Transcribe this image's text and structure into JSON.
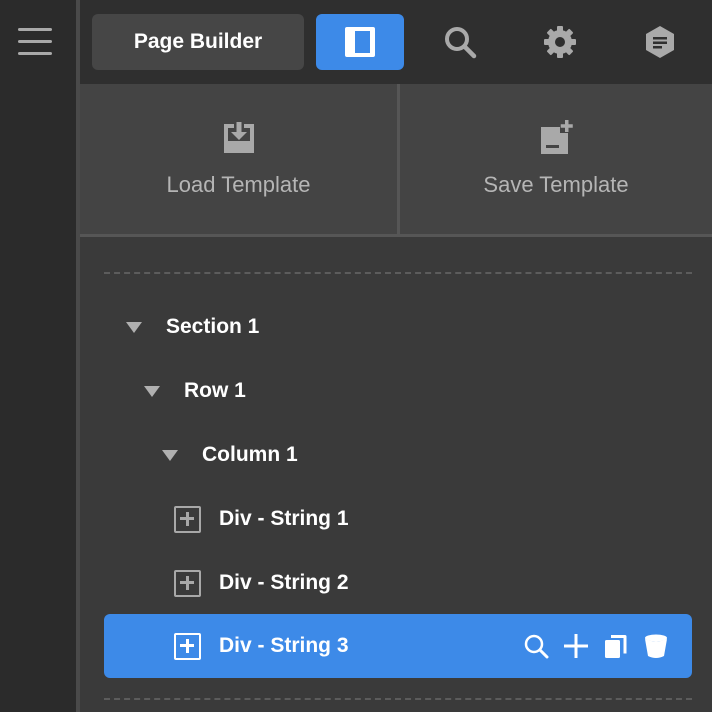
{
  "toolbar": {
    "title": "Page Builder",
    "panel_toggle_icon": "panel-layout-icon",
    "search_icon": "search-icon",
    "settings_icon": "gear-icon",
    "info_icon": "hexagon-note-icon",
    "accent": "#3d8ae8"
  },
  "templates": {
    "load_label": "Load Template",
    "load_icon": "download-tray-icon",
    "save_label": "Save Template",
    "save_icon": "add-document-icon"
  },
  "tree": {
    "section": "Section 1",
    "row": "Row 1",
    "column": "Column 1",
    "items": [
      "Div - String 1",
      "Div - String 2",
      "Div - String 3"
    ],
    "selected_index": 2,
    "selected_actions": [
      "search-icon",
      "plus-icon",
      "copy-icon",
      "trash-icon"
    ]
  }
}
